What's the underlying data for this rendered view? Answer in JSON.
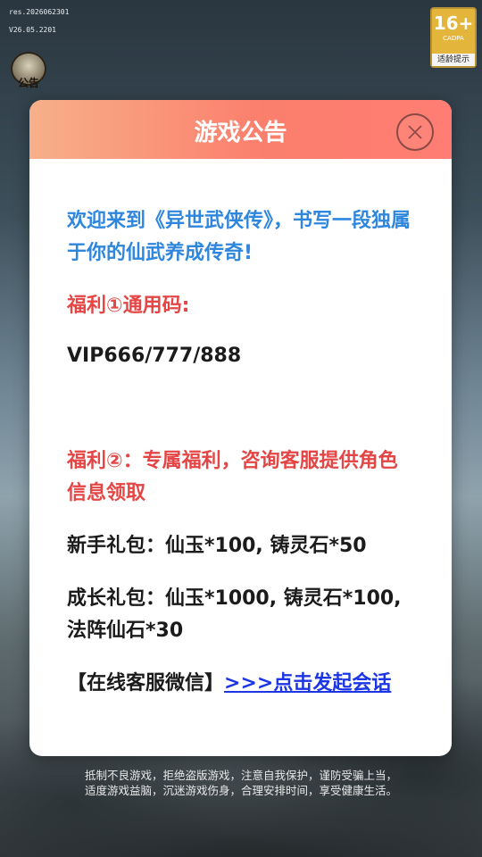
{
  "status": {
    "build_line_1": "res.2026062301",
    "build_line_2": "V26.05.2201"
  },
  "age_badge": {
    "rating": "16+",
    "org": "CADPA",
    "tip": "适龄提示"
  },
  "notice_icon": {
    "label": "公告"
  },
  "modal": {
    "title": "游戏公告",
    "welcome": "欢迎来到《异世武侠传》，书写一段独属于你的仙武养成传奇!",
    "benefit1_title": "福利①通用码:",
    "benefit1_code": "VIP666/777/888",
    "benefit2_title": "福利②：专属福利，咨询客服提供角色信息领取",
    "pack_newbie": "新手礼包：仙玉*100, 铸灵石*50",
    "pack_growth": "成长礼包：仙玉*1000, 铸灵石*100, 法阵仙石*30",
    "contact_prefix": "【在线客服微信】",
    "contact_link": ">>>点击发起会话"
  },
  "footer": {
    "health_line_1": "抵制不良游戏，拒绝盗版游戏，注意自我保护，谨防受骗上当，",
    "health_line_2": "适度游戏益脑，沉迷游戏伤身，合理安排时间，享受健康生活。"
  },
  "colors": {
    "header_gradient_start": "#f7b08a",
    "header_gradient_end": "#ff7d73",
    "welcome_text": "#2f86dd",
    "benefit_title": "#e44545",
    "link": "#1d36e4"
  }
}
